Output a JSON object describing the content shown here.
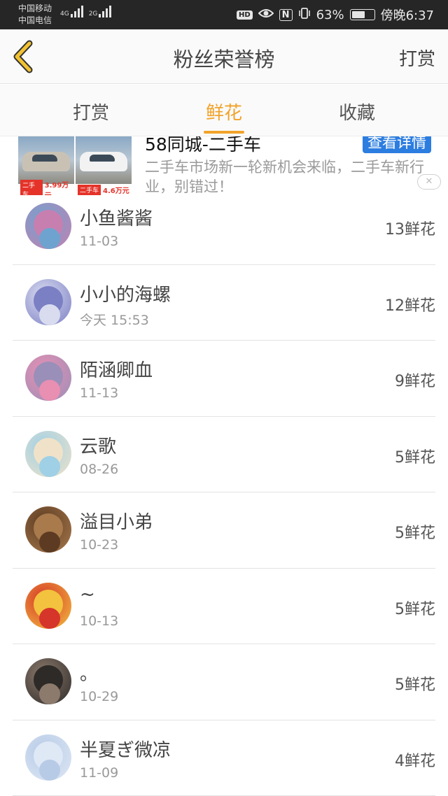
{
  "status_bar": {
    "carrier1": "中国移动",
    "carrier2": "中国电信",
    "net1": "4G",
    "net2": "2G",
    "hd": "HD",
    "nfc": "N",
    "battery_pct_text": "63%",
    "battery_level": 0.63,
    "time": "傍晚6:37",
    "icons": [
      "eye-icon",
      "vibrate-icon"
    ]
  },
  "header": {
    "title": "粉丝荣誉榜",
    "reward_button": "打赏",
    "back_icon": "chevron-left-icon",
    "accent": "#f2a32a"
  },
  "tabs": [
    {
      "label": "打赏",
      "active": false
    },
    {
      "label": "鲜花",
      "active": true
    },
    {
      "label": "收藏",
      "active": false
    }
  ],
  "ad": {
    "title": "58同城-二手车",
    "button": "查看详情",
    "description": "二手车市场新一轮新机会来临，二手车新行业，别错过！",
    "images": [
      {
        "tag": "二手车",
        "price": "3.99万元"
      },
      {
        "tag": "二手车",
        "price": "4.6万元"
      }
    ],
    "close_icon": "close-icon",
    "close_glyph": "✕"
  },
  "fans": [
    {
      "name": "小鱼酱酱",
      "date": "11-03",
      "count": "13鲜花",
      "colors": [
        "#c77fb0",
        "#6fa3cf"
      ]
    },
    {
      "name": "小小的海螺",
      "date": "今天 15:53",
      "count": "12鲜花",
      "colors": [
        "#7b7fc4",
        "#d9dcef"
      ]
    },
    {
      "name": "陌涵卿血",
      "date": "11-13",
      "count": "9鲜花",
      "colors": [
        "#9a8fb8",
        "#e88fb2"
      ]
    },
    {
      "name": "云歌",
      "date": "08-26",
      "count": "5鲜花",
      "colors": [
        "#f0e2c8",
        "#9fd0e6"
      ]
    },
    {
      "name": "溢目小弟",
      "date": "10-23",
      "count": "5鲜花",
      "colors": [
        "#a87a4c",
        "#5c3b22"
      ]
    },
    {
      "name": "~",
      "date": "10-13",
      "count": "5鲜花",
      "colors": [
        "#f3c23e",
        "#d6352a"
      ]
    },
    {
      "name": "。",
      "date": "10-29",
      "count": "5鲜花",
      "colors": [
        "#2d2a28",
        "#8c7a6c"
      ]
    },
    {
      "name": "半夏ぎ微凉",
      "date": "11-09",
      "count": "4鲜花",
      "colors": [
        "#dfe8f5",
        "#b7cbe6"
      ]
    }
  ]
}
